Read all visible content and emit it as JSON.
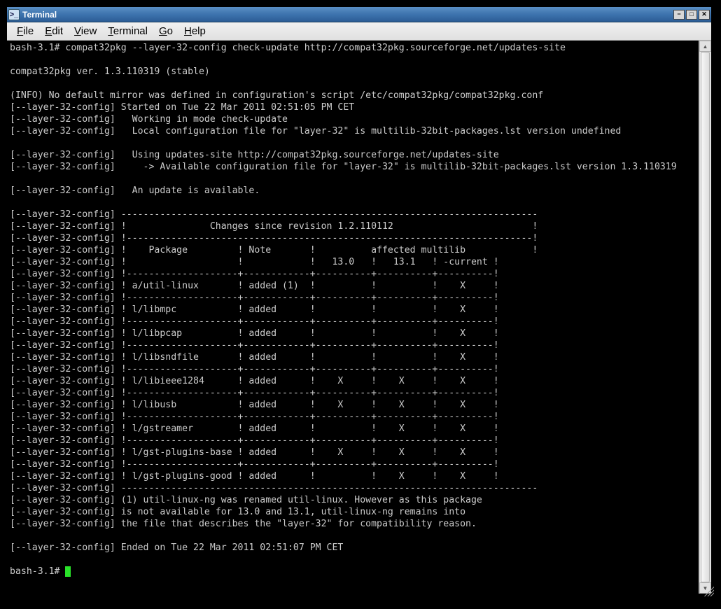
{
  "window": {
    "title": "Terminal"
  },
  "menubar": {
    "items": [
      {
        "label": "File",
        "ul": "F",
        "rest": "ile"
      },
      {
        "label": "Edit",
        "ul": "E",
        "rest": "dit"
      },
      {
        "label": "View",
        "ul": "V",
        "rest": "iew"
      },
      {
        "label": "Terminal",
        "ul": "T",
        "rest": "erminal"
      },
      {
        "label": "Go",
        "ul": "G",
        "rest": "o"
      },
      {
        "label": "Help",
        "ul": "H",
        "rest": "elp"
      }
    ]
  },
  "icons": {
    "terminal": ">_",
    "minimize": "−",
    "maximize": "□",
    "close": "✕",
    "up": "▲",
    "down": "▼"
  },
  "terminal": {
    "prompt": "bash-3.1# ",
    "command": "compat32pkg --layer-32-config check-update http://compat32pkg.sourceforge.net/updates-site",
    "lines": [
      "",
      "compat32pkg ver. 1.3.110319 (stable)",
      "",
      "(INFO) No default mirror was defined in configuration's script /etc/compat32pkg/compat32pkg.conf",
      "[--layer-32-config] Started on Tue 22 Mar 2011 02:51:05 PM CET",
      "[--layer-32-config]   Working in mode check-update",
      "[--layer-32-config]   Local configuration file for \"layer-32\" is multilib-32bit-packages.lst version undefined",
      "",
      "[--layer-32-config]   Using updates-site http://compat32pkg.sourceforge.net/updates-site",
      "[--layer-32-config]     -> Available configuration file for \"layer-32\" is multilib-32bit-packages.lst version 1.3.110319",
      "",
      "[--layer-32-config]   An update is available.",
      "",
      "[--layer-32-config] ---------------------------------------------------------------------------",
      "[--layer-32-config] !               Changes since revision 1.2.110112                         !",
      "[--layer-32-config] !-------------------------------------------------------------------------!",
      "[--layer-32-config] !    Package         ! Note       !          affected multilib            !",
      "[--layer-32-config] !                    !            !   13.0   !   13.1   ! -current !",
      "[--layer-32-config] !--------------------+------------+----------+----------+----------!",
      "[--layer-32-config] ! a/util-linux       ! added (1)  !          !          !    X     !",
      "[--layer-32-config] !--------------------+------------+----------+----------+----------!",
      "[--layer-32-config] ! l/libmpc           ! added      !          !          !    X     !",
      "[--layer-32-config] !--------------------+------------+----------+----------+----------!",
      "[--layer-32-config] ! l/libpcap          ! added      !          !          !    X     !",
      "[--layer-32-config] !--------------------+------------+----------+----------+----------!",
      "[--layer-32-config] ! l/libsndfile       ! added      !          !          !    X     !",
      "[--layer-32-config] !--------------------+------------+----------+----------+----------!",
      "[--layer-32-config] ! l/libieee1284      ! added      !    X     !    X     !    X     !",
      "[--layer-32-config] !--------------------+------------+----------+----------+----------!",
      "[--layer-32-config] ! l/libusb           ! added      !    X     !    X     !    X     !",
      "[--layer-32-config] !--------------------+------------+----------+----------+----------!",
      "[--layer-32-config] ! l/gstreamer        ! added      !          !    X     !    X     !",
      "[--layer-32-config] !--------------------+------------+----------+----------+----------!",
      "[--layer-32-config] ! l/gst-plugins-base ! added      !    X     !    X     !    X     !",
      "[--layer-32-config] !--------------------+------------+----------+----------+----------!",
      "[--layer-32-config] ! l/gst-plugins-good ! added      !          !    X     !    X     !",
      "[--layer-32-config] ---------------------------------------------------------------------------",
      "[--layer-32-config] (1) util-linux-ng was renamed util-linux. However as this package",
      "[--layer-32-config] is not available for 13.0 and 13.1, util-linux-ng remains into",
      "[--layer-32-config] the file that describes the \"layer-32\" for compatibility reason.",
      "",
      "[--layer-32-config] Ended on Tue 22 Mar 2011 02:51:07 PM CET",
      ""
    ]
  },
  "chart_data": {
    "type": "table",
    "title": "Changes since revision 1.2.110112",
    "columns": [
      "Package",
      "Note",
      "13.0",
      "13.1",
      "-current"
    ],
    "rows": [
      {
        "Package": "a/util-linux",
        "Note": "added (1)",
        "13.0": "",
        "13.1": "",
        "-current": "X"
      },
      {
        "Package": "l/libmpc",
        "Note": "added",
        "13.0": "",
        "13.1": "",
        "-current": "X"
      },
      {
        "Package": "l/libpcap",
        "Note": "added",
        "13.0": "",
        "13.1": "",
        "-current": "X"
      },
      {
        "Package": "l/libsndfile",
        "Note": "added",
        "13.0": "",
        "13.1": "",
        "-current": "X"
      },
      {
        "Package": "l/libieee1284",
        "Note": "added",
        "13.0": "X",
        "13.1": "X",
        "-current": "X"
      },
      {
        "Package": "l/libusb",
        "Note": "added",
        "13.0": "X",
        "13.1": "X",
        "-current": "X"
      },
      {
        "Package": "l/gstreamer",
        "Note": "added",
        "13.0": "",
        "13.1": "X",
        "-current": "X"
      },
      {
        "Package": "l/gst-plugins-base",
        "Note": "added",
        "13.0": "X",
        "13.1": "X",
        "-current": "X"
      },
      {
        "Package": "l/gst-plugins-good",
        "Note": "added",
        "13.0": "",
        "13.1": "X",
        "-current": "X"
      }
    ],
    "footnotes": [
      "(1) util-linux-ng was renamed util-linux. However as this package is not available for 13.0 and 13.1, util-linux-ng remains into the file that describes the \"layer-32\" for compatibility reason."
    ]
  }
}
